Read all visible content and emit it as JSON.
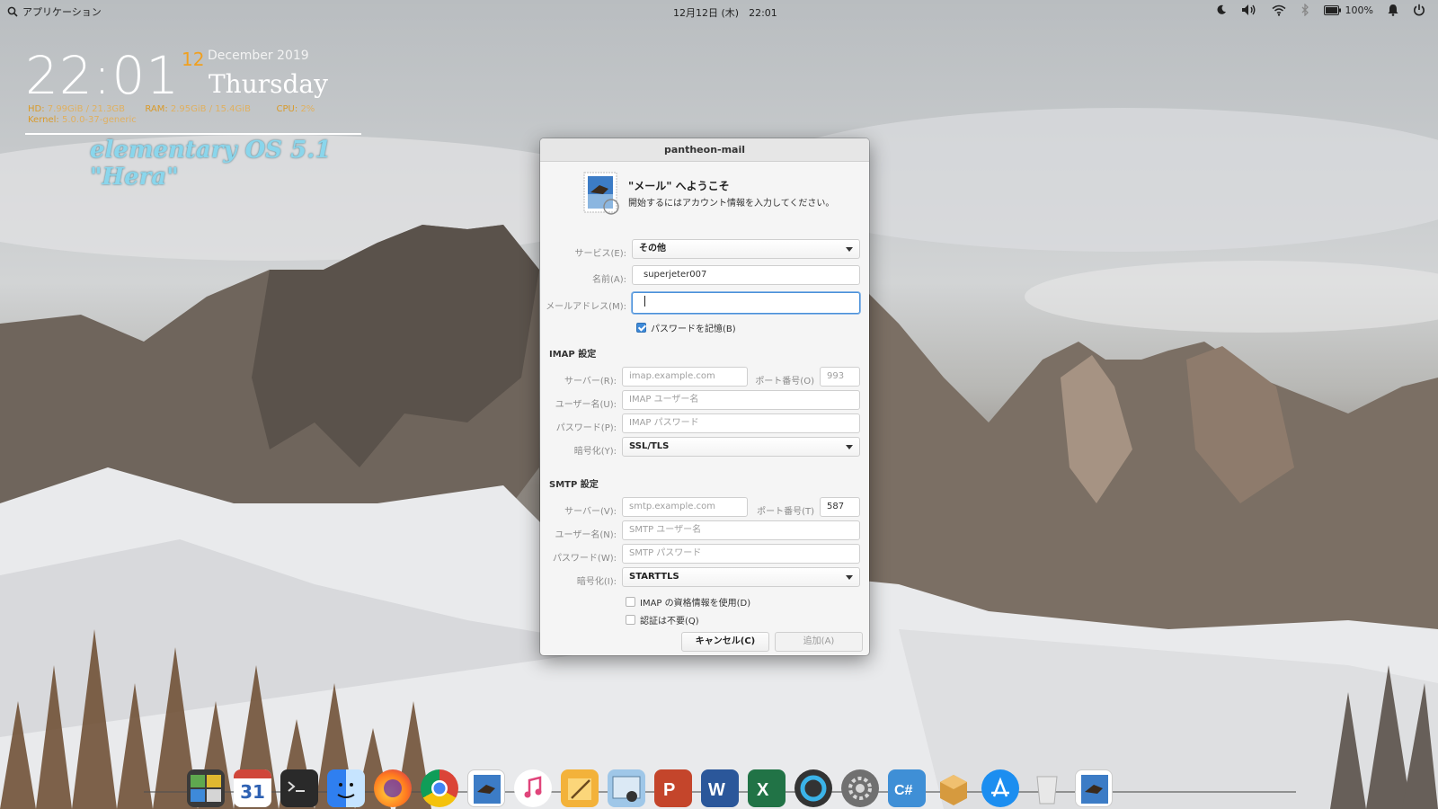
{
  "panel": {
    "apps_label": "アプリケーション",
    "datetime": "12月12日 (木)　22:01",
    "battery": "100%"
  },
  "conky": {
    "time": "22:01",
    "day": "12",
    "month_year": "December 2019",
    "weekday": "Thursday",
    "hdd_label": "HD:",
    "hdd_value": "7.99GiB / 21.3GB",
    "ram_label": "RAM:",
    "ram_value": "2.95GiB / 15.4GiB",
    "cpu_label": "CPU:",
    "cpu_value": "2%",
    "kernel_label": "Kernel:",
    "kernel_value": "5.0.0-37-generic",
    "os_name": "elementary OS 5.1 \"Hera\""
  },
  "dialog": {
    "title": "pantheon-mail",
    "welcome_heading": "\"メール\" へようこそ",
    "welcome_sub": "開始するにはアカウント情報を入力してください。",
    "service_label": "サービス(E):",
    "service_value": "その他",
    "name_label": "名前(A):",
    "name_value": "superjeter007",
    "email_label": "メールアドレス(M):",
    "email_value": "",
    "remember_password": "パスワードを記憶(B)",
    "imap": {
      "heading": "IMAP 設定",
      "server_label": "サーバー(R):",
      "server_placeholder": "imap.example.com",
      "port_label": "ポート番号(O)",
      "port_value": "993",
      "user_label": "ユーザー名(U):",
      "user_placeholder": "IMAP ユーザー名",
      "password_label": "パスワード(P):",
      "password_placeholder": "IMAP パスワード",
      "enc_label": "暗号化(Y):",
      "enc_value": "SSL/TLS"
    },
    "smtp": {
      "heading": "SMTP 設定",
      "server_label": "サーバー(V):",
      "server_placeholder": "smtp.example.com",
      "port_label": "ポート番号(T)",
      "port_value": "587",
      "user_label": "ユーザー名(N):",
      "user_placeholder": "SMTP ユーザー名",
      "password_label": "パスワード(W):",
      "password_placeholder": "SMTP パスワード",
      "enc_label": "暗号化(I):",
      "enc_value": "STARTTLS",
      "use_imap_credentials": "IMAP の資格情報を使用(D)",
      "no_auth": "認証は不要(Q)"
    },
    "cancel_button": "キャンセル(C)",
    "add_button": "追加(A)"
  },
  "dock": {
    "calendar_day": "31",
    "items": [
      "multitasking-view",
      "calendar",
      "terminal",
      "finder",
      "firefox",
      "chrome",
      "mail",
      "music",
      "notes",
      "image-viewer",
      "powerpoint",
      "word",
      "excel",
      "browser",
      "system-settings",
      "code-editor",
      "package-installer",
      "app-store",
      "trash",
      "mail-running"
    ]
  },
  "colors": {
    "accent": "#3e8ad9",
    "conky_orange": "#f0a020",
    "os_name_cyan": "#8ad6ec"
  }
}
